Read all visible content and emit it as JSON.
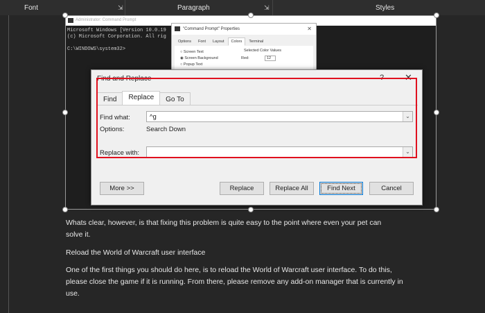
{
  "ribbon": {
    "groups": [
      "Font",
      "Paragraph",
      "Styles"
    ]
  },
  "cmd": {
    "title": "Administrator: Command Prompt",
    "lines": [
      "Microsoft Windows [Version 10.0.19",
      "(c) Microsoft Corporation. All rig",
      "",
      "C:\\WINDOWS\\system32>"
    ]
  },
  "props": {
    "title": "\"Command Prompt\" Properties",
    "tabs": [
      "Options",
      "Font",
      "Layout",
      "Colors",
      "Terminal"
    ],
    "radios": [
      "Screen Text",
      "Screen Background",
      "Popup Text"
    ],
    "group": "Selected Color Values",
    "red_label": "Red:",
    "red_value": "12"
  },
  "dialog": {
    "title": "Find and Replace",
    "help": "?",
    "close": "✕",
    "tabs": [
      "Find",
      "Replace",
      "Go To"
    ],
    "find_label": "Find what:",
    "find_value": "^g",
    "options_label": "Options:",
    "options_value": "Search Down",
    "replace_label": "Replace with:",
    "replace_value": "",
    "buttons": {
      "more": "More >>",
      "replace": "Replace",
      "replace_all": "Replace All",
      "find_next": "Find Next",
      "cancel": "Cancel"
    }
  },
  "doc": {
    "paragraphs": [
      [
        "Whats clear, however, is that fixing this problem is quite easy to the point where even your pet can",
        "solve it."
      ],
      [
        "Reload the World of Warcraft user interface"
      ],
      [
        "One of the first things you should do here, is to reload the World of Warcraft user interface. To do this,",
        "please close the game if it is running. From there, please remove any add-on manager that is currently in",
        "use."
      ]
    ]
  }
}
